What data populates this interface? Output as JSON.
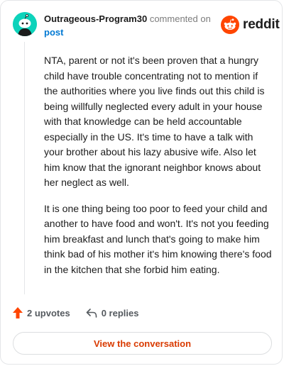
{
  "comment": {
    "username": "Outrageous-Program30",
    "commented_on": "commented on",
    "post_link": "post",
    "paragraphs": [
      "NTA, parent or not it's been proven that a hungry child have trouble concentrating not to mention if the authorities where you live finds out this child is being willfully neglected every adult in your house with that knowledge can be held accountable especially in the US. It's time to have a talk with your brother about his lazy abusive wife. Also let him know that the ignorant neighbor knows about her neglect as well.",
      "It is one thing being too poor to feed your child and another to have food and won't. It's not you feeding him breakfast and lunch that's going to make him think bad of his mother it's him knowing there's food in the kitchen that she forbid him eating."
    ]
  },
  "brand": {
    "wordmark": "reddit",
    "icon": "reddit-alien-icon",
    "color": "#ff4500"
  },
  "avatar": {
    "icon": "snoo-avatar-icon",
    "color": "#0dd3bb"
  },
  "actions": {
    "upvotes": "2 upvotes",
    "replies": "0 replies",
    "upvote_icon": "upvote-arrow-icon",
    "reply_icon": "reply-arrow-icon",
    "upvote_color": "#ff4500"
  },
  "cta": {
    "label": "View the conversation",
    "color": "#d93a00"
  }
}
